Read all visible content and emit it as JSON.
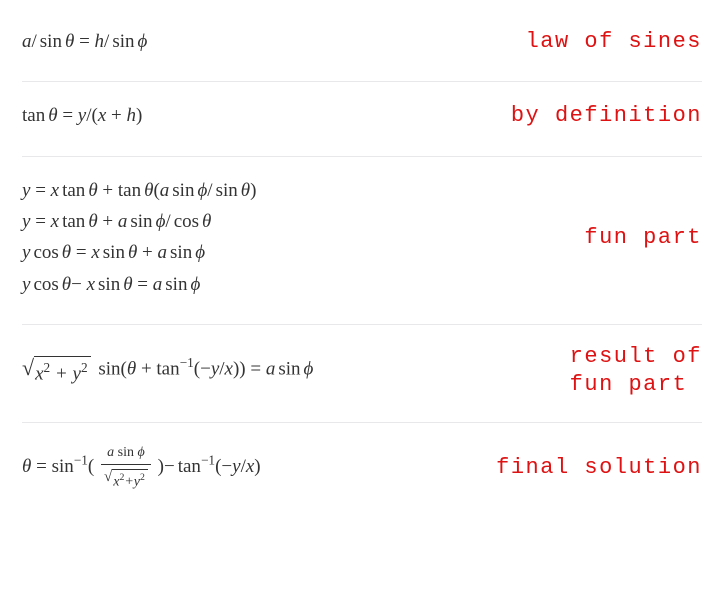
{
  "rows": [
    {
      "note": "law of sines",
      "lines": [
        "a/ sin θ = h/ sin ϕ"
      ]
    },
    {
      "note": "by definition",
      "lines": [
        "tan θ = y/(x + h)"
      ]
    },
    {
      "note": "fun part",
      "lines": [
        "y = x tan θ + tan θ(a sin ϕ/ sin θ)",
        "y = x tan θ + a sin ϕ/ cos θ",
        "y cos θ = x sin θ + a sin ϕ",
        "y cos θ− x sin θ = a sin ϕ"
      ]
    },
    {
      "note": "result of\nfun part",
      "lines": [
        "√(x² + y²) sin(θ + tan⁻¹(−y/x)) = a sin ϕ"
      ]
    },
    {
      "note": "final solution",
      "lines": [
        "θ = sin⁻¹( a sin ϕ / √(x²+y²) )− tan⁻¹(−y/x)"
      ]
    }
  ]
}
